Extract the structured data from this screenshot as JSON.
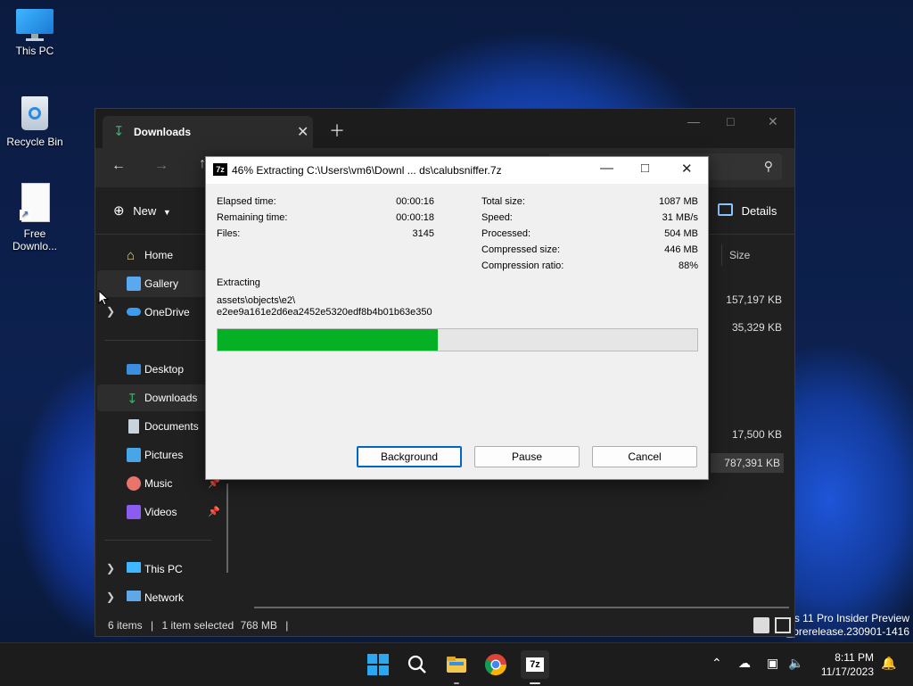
{
  "desktop": {
    "icons": [
      {
        "label": "This PC"
      },
      {
        "label": "Recycle Bin"
      },
      {
        "label": "Free Downlo..."
      }
    ],
    "watermark": {
      "line1": "ws 11 Pro Insider Preview",
      "line2": "s_prerelease.230901-1416"
    }
  },
  "explorer": {
    "tab_title": "Downloads",
    "new_label": "New",
    "details_label": "Details",
    "column_size": "Size",
    "sidebar": [
      {
        "label": "Home",
        "icon": "home-icon"
      },
      {
        "label": "Gallery",
        "icon": "gallery-icon"
      },
      {
        "label": "OneDrive",
        "icon": "onedrive-icon"
      },
      {
        "label": "Desktop",
        "icon": "desktop-folder-icon"
      },
      {
        "label": "Downloads",
        "icon": "downloads-folder-icon"
      },
      {
        "label": "Documents",
        "icon": "documents-folder-icon"
      },
      {
        "label": "Pictures",
        "icon": "pictures-folder-icon"
      },
      {
        "label": "Music",
        "icon": "music-folder-icon"
      },
      {
        "label": "Videos",
        "icon": "videos-folder-icon"
      },
      {
        "label": "This PC",
        "icon": "this-pc-icon"
      },
      {
        "label": "Network",
        "icon": "network-icon"
      }
    ],
    "sizes": [
      "157,197 KB",
      "35,329 KB",
      "17,500 KB",
      "787,391 KB"
    ],
    "status": {
      "items": "6 items",
      "selected": "1 item selected",
      "sel_size": "768 MB"
    }
  },
  "dialog": {
    "title": "46% Extracting C:\\Users\\vm6\\Downl ... ds\\calubsniffer.7z",
    "left_stats": [
      {
        "label": "Elapsed time:",
        "value": "00:00:16"
      },
      {
        "label": "Remaining time:",
        "value": "00:00:18"
      },
      {
        "label": "Files:",
        "value": "3145"
      }
    ],
    "right_stats": [
      {
        "label": "Total size:",
        "value": "1087 MB"
      },
      {
        "label": "Speed:",
        "value": "31 MB/s"
      },
      {
        "label": "Processed:",
        "value": "504 MB"
      },
      {
        "label": "Compressed size:",
        "value": "446 MB"
      },
      {
        "label": "Compression ratio:",
        "value": "88%"
      }
    ],
    "extracting_label": "Extracting",
    "path_line1": "assets\\objects\\e2\\",
    "path_line2": "e2ee9a161e2d6ea2452e5320edf8b4b01b63e350",
    "progress": 0.46,
    "buttons": {
      "background": "Background",
      "pause": "Pause",
      "cancel": "Cancel"
    }
  },
  "taskbar": {
    "time": "8:11 PM",
    "date": "11/17/2023"
  },
  "colors": {
    "progress_fill": "#06b025",
    "accent": "#0067c0"
  }
}
